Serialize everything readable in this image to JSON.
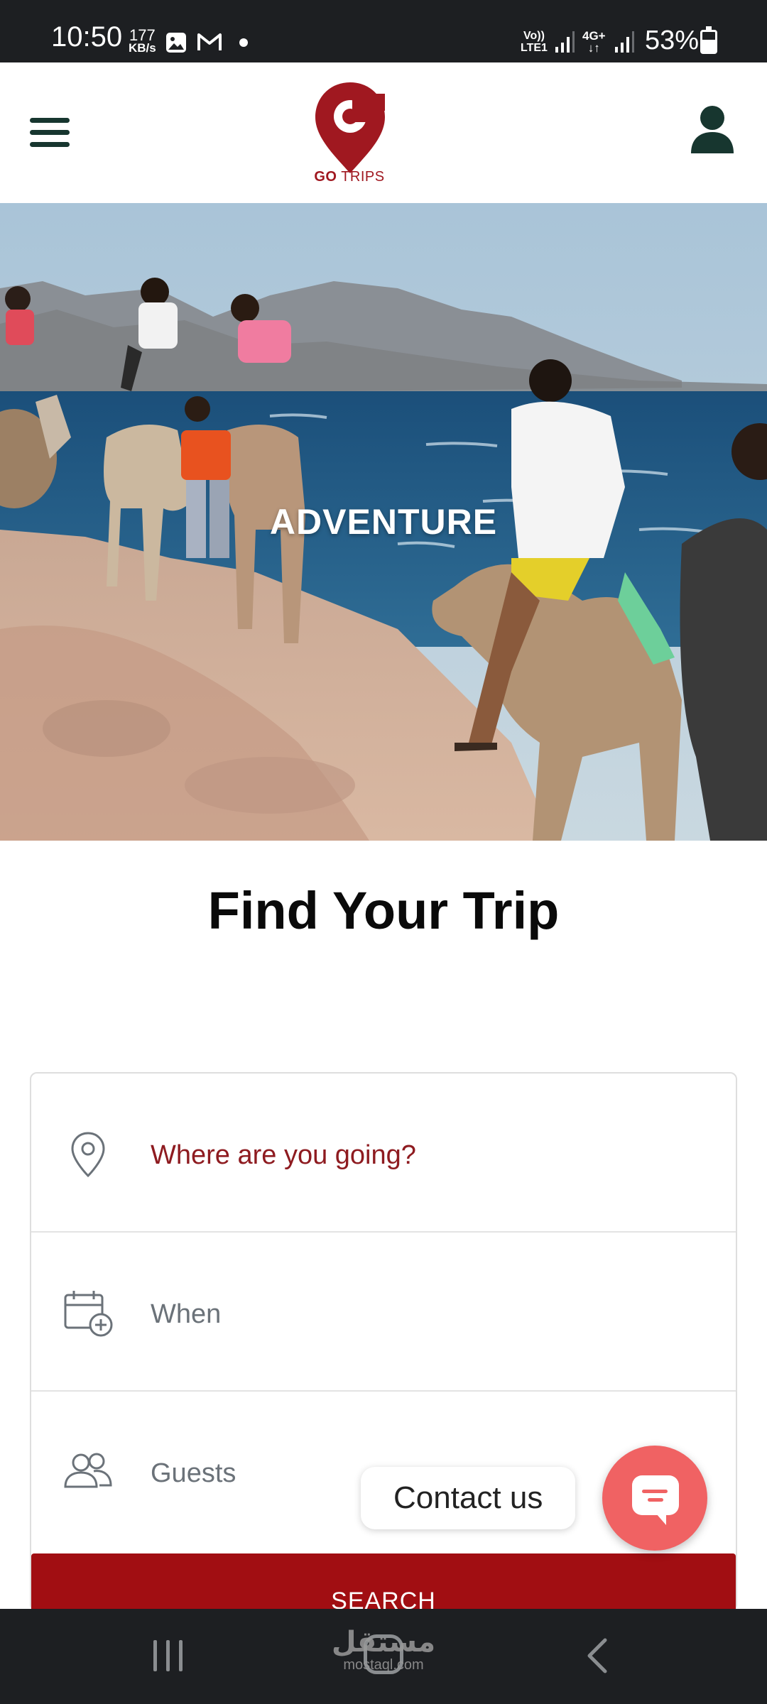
{
  "status_bar": {
    "time": "10:50",
    "speed_value": "177",
    "speed_unit": "KB/s",
    "volte_top": "Vo))",
    "volte_bottom": "LTE1",
    "network": "4G+",
    "battery": "53%"
  },
  "header": {
    "logo_letter": "G",
    "logo_text_bold": "GO",
    "logo_text_rest": "TRIPS",
    "menu_icon": "hamburger-icon",
    "user_icon": "user-icon",
    "brand_color": "#a01820"
  },
  "hero": {
    "caption": "ADVENTURE"
  },
  "main": {
    "title": "Find Your Trip"
  },
  "search_form": {
    "destination_placeholder": "Where are you going?",
    "date_placeholder": "When",
    "guests_placeholder": "Guests",
    "submit_label": "SEARCH",
    "accent_color": "#a10e12"
  },
  "contact_widget": {
    "label": "Contact us",
    "icon": "chat-icon",
    "color": "#f06263"
  },
  "watermark": {
    "arabic": "مستقل",
    "latin": "mostaql.com"
  }
}
